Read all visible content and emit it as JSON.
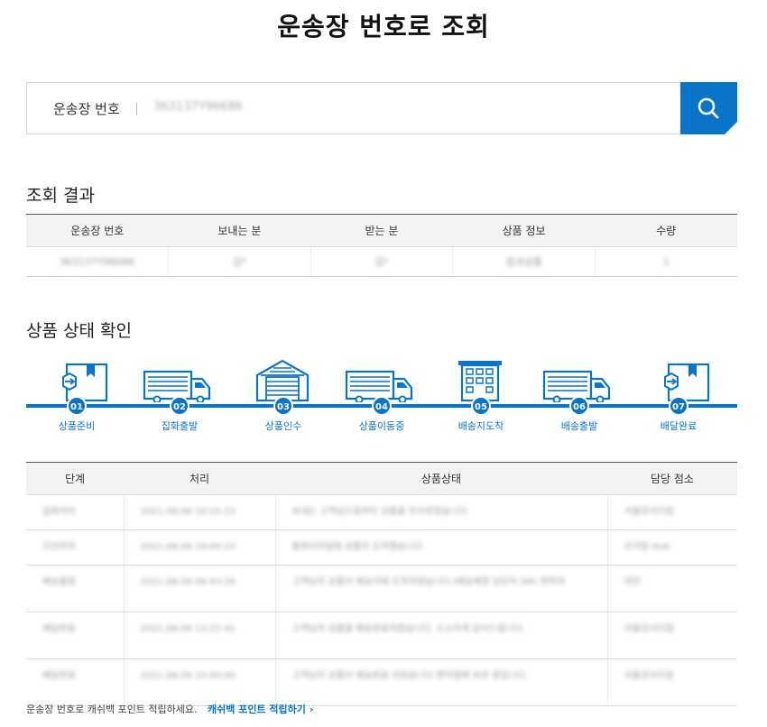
{
  "page_title": "운송장 번호로 조회",
  "search": {
    "label": "운송장 번호",
    "value": "363137Y96686",
    "button_icon": "search-icon"
  },
  "result": {
    "title": "조회 결과",
    "headers": [
      "운송장 번호",
      "보내는 분",
      "받는 분",
      "상품 정보",
      "수량"
    ],
    "row": [
      "363137Y96686",
      "김*",
      "김*",
      "청과상품",
      "1"
    ]
  },
  "status": {
    "title": "상품 상태 확인",
    "steps": [
      {
        "num": "01",
        "label": "상품준비",
        "icon": "box-arrow-icon"
      },
      {
        "num": "02",
        "label": "집화출발",
        "icon": "truck-icon"
      },
      {
        "num": "03",
        "label": "상품인수",
        "icon": "warehouse-icon"
      },
      {
        "num": "04",
        "label": "상품이동중",
        "icon": "truck-icon"
      },
      {
        "num": "05",
        "label": "배송지도착",
        "icon": "building-icon"
      },
      {
        "num": "06",
        "label": "배송출발",
        "icon": "truck-icon"
      },
      {
        "num": "07",
        "label": "배달완료",
        "icon": "box-arrow-icon"
      }
    ]
  },
  "detail": {
    "headers": [
      "단계",
      "처리",
      "상품상태",
      "담당 점소"
    ],
    "rows": [
      [
        "집화처리",
        "2021.08.08 10:15:23",
        "보내는 고객님으로부터 상품을 인수받았습니다.",
        "서울강서지점"
      ],
      [
        "간선하차",
        "2021.08.08 19:04:33",
        "물류터미널에 상품이 도착했습니다.",
        "곤지암 Hub"
      ],
      [
        "배송출발",
        "2021.08.09 06:43:29",
        "고객님의 상품이 배송지에 도착하였습니다.(배송예정 담당자 SM) 연락처",
        "대전"
      ],
      [
        "배달완료",
        "2021.08.09 13:22:41",
        "고객님의 상품을 배송완료하였습니다. 소소하게 감사드립니다.",
        "서울강서지점"
      ],
      [
        "배달완료",
        "2021.08.09 15:00:00",
        "고객님의 상품이 배송완료 되었습니다 편의점에 보관 중입니다.",
        "서울강서지점"
      ]
    ]
  },
  "footer": {
    "text": "운송장 번호로 캐쉬백 포인트 적립하세요.",
    "link": "캐쉬백 포인트 적립하기 ›"
  },
  "colors": {
    "accent": "#0a74c9"
  }
}
